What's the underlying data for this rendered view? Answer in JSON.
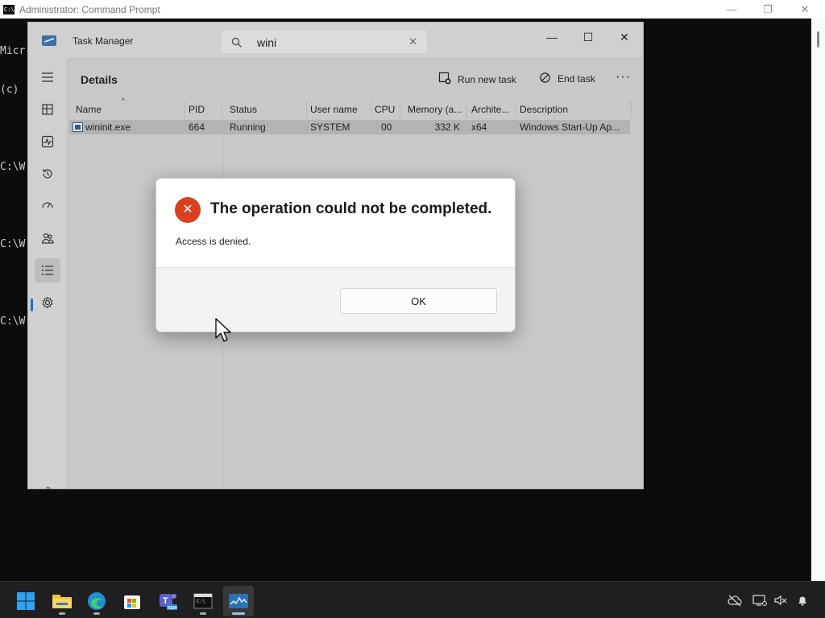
{
  "cmd": {
    "title": "Administrator: Command Prompt",
    "lines": [
      "Micr",
      "(c) ",
      "",
      "C:\\W",
      "",
      "C:\\W",
      "",
      "C:\\W"
    ],
    "controls": {
      "minimize": "—",
      "restore": "❐",
      "close": "✕"
    }
  },
  "task_manager": {
    "title": "Task Manager",
    "search": {
      "value": "wini",
      "clear": "✕"
    },
    "controls": {
      "minimize": "—",
      "maximize": "☐",
      "close": "✕"
    },
    "sidebar": {
      "items": [
        {
          "name": "menu-icon",
          "glyph": "☰"
        },
        {
          "name": "processes-icon",
          "glyph": "▦"
        },
        {
          "name": "performance-icon",
          "glyph": "⌁"
        },
        {
          "name": "app-history-icon",
          "glyph": "↺"
        },
        {
          "name": "startup-apps-icon",
          "glyph": "⚡"
        },
        {
          "name": "users-icon",
          "glyph": "👥"
        },
        {
          "name": "details-icon",
          "glyph": "☷"
        },
        {
          "name": "services-icon",
          "glyph": "⚙"
        }
      ],
      "settings_glyph": "⚙"
    },
    "page_title": "Details",
    "toolbar": {
      "run_new_task": "Run new task",
      "end_task": "End task",
      "more": "···"
    },
    "columns": [
      "Name",
      "PID",
      "Status",
      "User name",
      "CPU",
      "Memory (a...",
      "Archite...",
      "Description"
    ],
    "rows": [
      {
        "name": "wininit.exe",
        "pid": "664",
        "status": "Running",
        "user": "SYSTEM",
        "cpu": "00",
        "memory": "332 K",
        "arch": "x64",
        "description": "Windows Start-Up Ap..."
      }
    ]
  },
  "dialog": {
    "title": "The operation could not be completed.",
    "message": "Access is denied.",
    "ok": "OK",
    "icon": "✕"
  },
  "colors": {
    "error": "#d9401f",
    "accent": "#1a6fd1"
  }
}
